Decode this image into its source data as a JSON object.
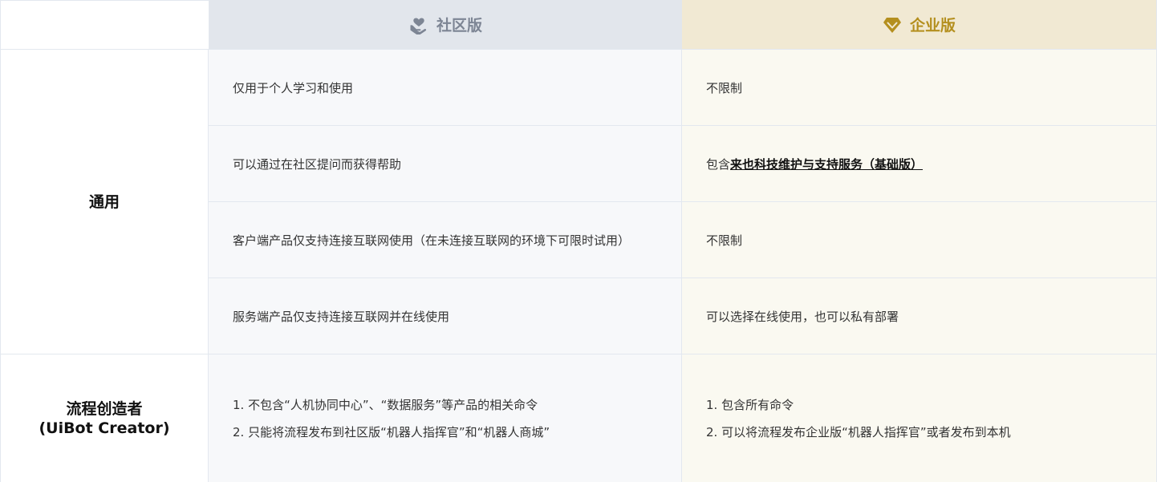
{
  "header": {
    "community": {
      "label": "社区版",
      "icon": "hand-heart-icon",
      "color": "#7d8594"
    },
    "enterprise": {
      "label": "企业版",
      "icon": "diamond-icon",
      "color": "#b48f1e"
    }
  },
  "categories": {
    "general": "通用",
    "creator_line1": "流程创造者",
    "creator_line2": "(UiBot Creator)"
  },
  "rows": [
    {
      "community": "仅用于个人学习和使用",
      "enterprise": "不限制"
    },
    {
      "community": "可以通过在社区提问而获得帮助",
      "enterprise_prefix": "包含",
      "enterprise_link": "来也科技维护与支持服务（基础版）"
    },
    {
      "community": "客户端产品仅支持连接互联网使用（在未连接互联网的环境下可限时试用）",
      "enterprise": "不限制"
    },
    {
      "community": "服务端产品仅支持连接互联网并在线使用",
      "enterprise": "可以选择在线使用，也可以私有部署"
    }
  ],
  "creator": {
    "community": [
      "1. 不包含“人机协同中心”、“数据服务”等产品的相关命令",
      "2. 只能将流程发布到社区版“机器人指挥官”和“机器人商城”"
    ],
    "enterprise": [
      "1. 包含所有命令",
      "2. 可以将流程发布企业版“机器人指挥官”或者发布到本机"
    ]
  }
}
